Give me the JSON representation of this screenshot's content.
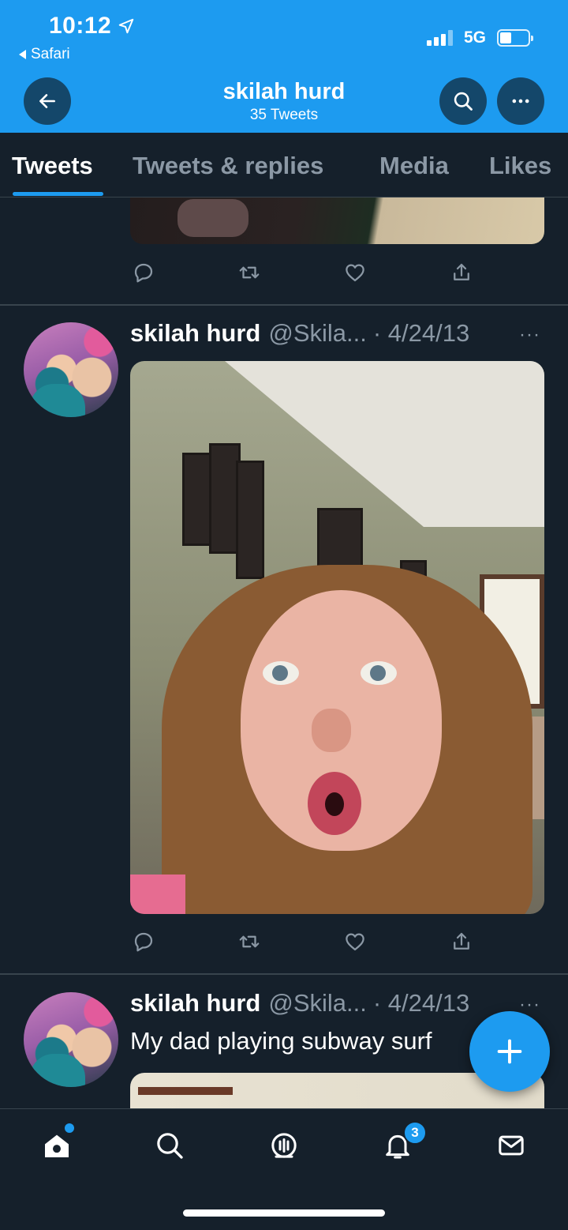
{
  "status_bar": {
    "time": "10:12",
    "back_app": "Safari",
    "network": "5G"
  },
  "header": {
    "profile_name": "skilah hurd",
    "tweet_count": "35 Tweets",
    "accent_color": "#1d9bf0"
  },
  "tabs": [
    {
      "label": "Tweets",
      "active": true
    },
    {
      "label": "Tweets & replies",
      "active": false
    },
    {
      "label": "Media",
      "active": false
    },
    {
      "label": "Likes",
      "active": false
    }
  ],
  "tweets": [
    {
      "name": "skilah hurd",
      "handle": "@Skila...",
      "date": "· 4/24/13",
      "more": "···",
      "text": ""
    },
    {
      "name": "skilah hurd",
      "handle": "@Skila...",
      "date": "· 4/24/13",
      "more": "···",
      "text": "My dad playing subway surf"
    }
  ],
  "tweet_actions": [
    "reply-icon",
    "retweet-icon",
    "like-icon",
    "share-icon"
  ],
  "bottom_nav": {
    "items": [
      "home-icon",
      "search-icon",
      "spaces-icon",
      "notifications-icon",
      "messages-icon"
    ],
    "notification_badge": "3"
  },
  "colors": {
    "background": "#15202b",
    "divider": "#38444d",
    "secondary_text": "#8b98a5"
  }
}
